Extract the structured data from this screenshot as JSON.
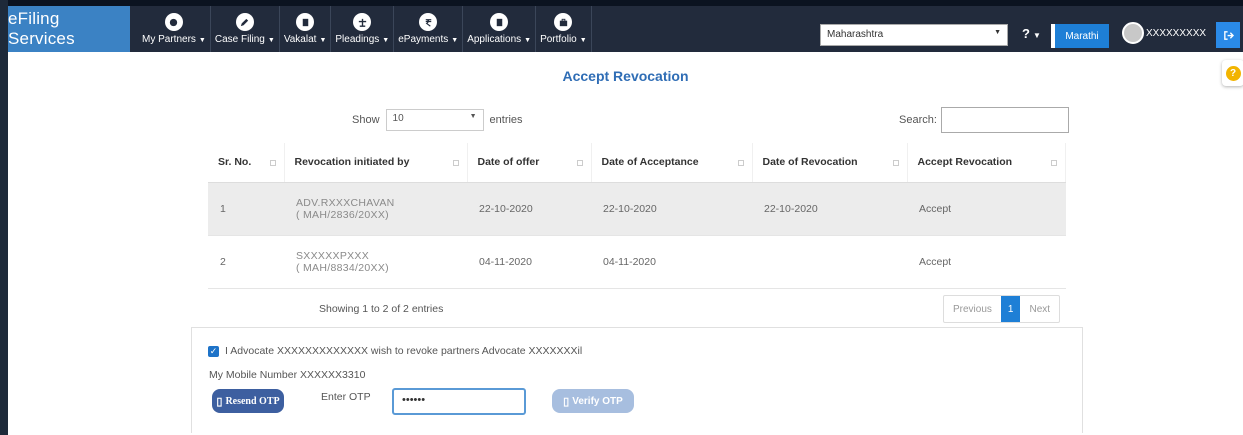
{
  "header": {
    "brand": "eFiling Services",
    "nav": [
      {
        "label": "My Partners",
        "icon": "handshake-icon"
      },
      {
        "label": "Case Filing",
        "icon": "pencil-icon"
      },
      {
        "label": "Vakalat",
        "icon": "document-icon"
      },
      {
        "label": "Pleadings",
        "icon": "scale-icon"
      },
      {
        "label": "ePayments",
        "icon": "rupee-icon"
      },
      {
        "label": "Applications",
        "icon": "file-icon"
      },
      {
        "label": "Portfolio",
        "icon": "briefcase-icon"
      }
    ],
    "state_select": "Maharashtra",
    "help": "?",
    "language": "Marathi",
    "username": "XXXXXXXXX"
  },
  "page": {
    "title": "Accept Revocation",
    "show_label": "Show",
    "entries_value": "10",
    "entries_label": "entries",
    "search_label": "Search:",
    "search_value": ""
  },
  "table": {
    "columns": [
      "Sr. No.",
      "Revocation initiated by",
      "Date of offer",
      "Date of Acceptance",
      "Date of Revocation",
      "Accept Revocation"
    ],
    "rows": [
      {
        "sr": "1",
        "name": "ADV.RXXXCHAVAN",
        "reg": "( MAH/2836/20XX)",
        "offer": "22-10-2020",
        "acceptance": "22-10-2020",
        "revocation": "22-10-2020",
        "action": "Accept"
      },
      {
        "sr": "2",
        "name": "SXXXXXPXXX",
        "reg": "( MAH/8834/20XX)",
        "offer": "04-11-2020",
        "acceptance": "04-11-2020",
        "revocation": "",
        "action": "Accept"
      }
    ],
    "info": "Showing 1 to 2 of 2 entries",
    "pager": {
      "prev": "Previous",
      "current": "1",
      "next": "Next"
    }
  },
  "otp": {
    "consent": "I Advocate XXXXXXXXXXXXX wish to revoke partners Advocate XXXXXXXil",
    "mobile": "My Mobile Number XXXXXX3310",
    "resend": "Resend OTP",
    "enter_label": "Enter OTP",
    "value": "••••••",
    "verify": "Verify OTP"
  },
  "colors": {
    "brand": "#3b82c4",
    "nav": "#222b3c",
    "accent": "#1e7fd6",
    "title": "#2f6db5"
  }
}
